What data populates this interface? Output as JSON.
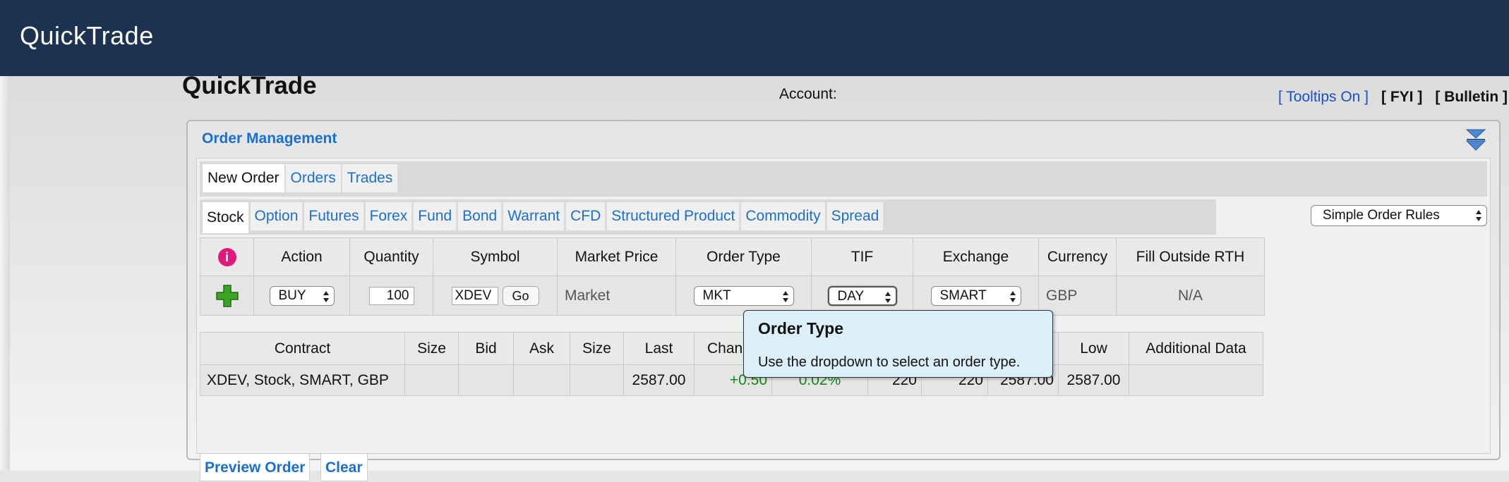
{
  "app": {
    "title": "QuickTrade"
  },
  "page": {
    "title": "QuickTrade",
    "account_label": "Account:"
  },
  "top_links": {
    "tooltips": "[ Tooltips On ]",
    "fyi": "[ FYI ]",
    "bulletin": "[ Bulletin ]"
  },
  "panel": {
    "title": "Order Management"
  },
  "main_tabs": [
    {
      "label": "New Order",
      "active": true
    },
    {
      "label": "Orders",
      "active": false
    },
    {
      "label": "Trades",
      "active": false
    }
  ],
  "asset_tabs": [
    {
      "label": "Stock",
      "active": true
    },
    {
      "label": "Option"
    },
    {
      "label": "Futures"
    },
    {
      "label": "Forex"
    },
    {
      "label": "Fund"
    },
    {
      "label": "Bond"
    },
    {
      "label": "Warrant"
    },
    {
      "label": "CFD"
    },
    {
      "label": "Structured Product"
    },
    {
      "label": "Commodity"
    },
    {
      "label": "Spread"
    }
  ],
  "order_rules": {
    "selected": "Simple Order Rules"
  },
  "order_table": {
    "headers": {
      "action": "Action",
      "quantity": "Quantity",
      "symbol": "Symbol",
      "market_price": "Market Price",
      "order_type": "Order Type",
      "tif": "TIF",
      "exchange": "Exchange",
      "currency": "Currency",
      "fill_outside_rth": "Fill Outside RTH"
    },
    "row": {
      "action": "BUY",
      "quantity": "100",
      "symbol": "XDEV",
      "go_label": "Go",
      "market_price": "Market",
      "order_type": "MKT",
      "tif": "DAY",
      "exchange": "SMART",
      "currency": "GBP",
      "fill_outside_rth": "N/A"
    },
    "info_glyph": "i"
  },
  "market_table": {
    "headers": {
      "contract": "Contract",
      "size1": "Size",
      "bid": "Bid",
      "ask": "Ask",
      "size2": "Size",
      "last": "Last",
      "change": "Chan",
      "low": "Low",
      "additional": "Additional Data"
    },
    "row": {
      "contract": "XDEV, Stock, SMART, GBP",
      "last": "2587.00",
      "change": "+0.50",
      "change_pct": "0.02%",
      "vol1": "220",
      "vol2": "220",
      "high": "2587.00",
      "low": "2587.00"
    }
  },
  "buttons": {
    "preview": "Preview Order",
    "clear": "Clear"
  },
  "tooltip": {
    "title": "Order Type",
    "body": "Use the dropdown to select an order type."
  },
  "colors": {
    "header_bg": "#1d3250",
    "link": "#1a6fd0",
    "positive": "#128a12",
    "info": "#e0197a",
    "add": "#3aa424",
    "tooltip_bg": "#dcf0fb"
  }
}
